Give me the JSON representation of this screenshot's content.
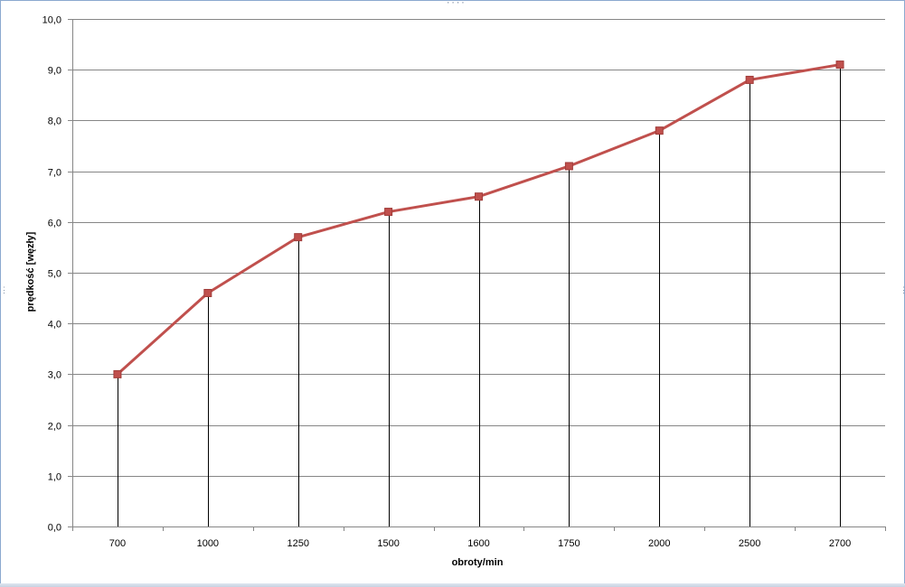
{
  "chart_data": {
    "type": "line",
    "title": "",
    "xlabel": "obroty/min",
    "ylabel": "prędkość [węzły]",
    "categories": [
      "700",
      "1000",
      "1250",
      "1500",
      "1600",
      "1750",
      "2000",
      "2500",
      "2700"
    ],
    "series": [
      {
        "values": [
          3.0,
          4.6,
          5.7,
          6.2,
          6.5,
          7.1,
          7.8,
          8.8,
          9.1
        ],
        "color": "#c0504d",
        "marker": "square"
      }
    ],
    "ylim": [
      0,
      10
    ],
    "yticks": [
      "0,0",
      "1,0",
      "2,0",
      "3,0",
      "4,0",
      "5,0",
      "6,0",
      "7,0",
      "8,0",
      "9,0",
      "10,0"
    ],
    "grid": true,
    "drop_lines": true,
    "legend": "none"
  },
  "colors": {
    "series": "#c0504d",
    "grid": "#868686",
    "drop_line": "#000000",
    "frame": "#8ba9cf"
  }
}
